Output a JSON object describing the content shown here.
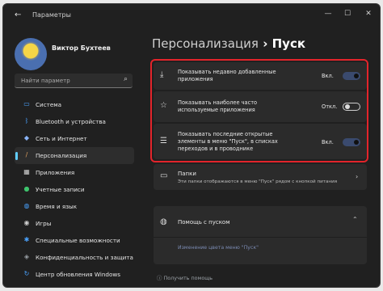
{
  "window": {
    "title": "Параметры",
    "back_icon": "arrow-left-icon",
    "controls": [
      "—",
      "☐",
      "✕"
    ]
  },
  "user": {
    "name": "Виктор Бухтеев"
  },
  "search": {
    "placeholder": "Найти параметр"
  },
  "sidebar": {
    "items": [
      {
        "label": "Система",
        "icon": "monitor-icon",
        "color": "#4aa3ff"
      },
      {
        "label": "Bluetooth и устройства",
        "icon": "bluetooth-icon",
        "color": "#4aa3ff"
      },
      {
        "label": "Сеть и Интернет",
        "icon": "wifi-icon",
        "color": "#8ab4f8"
      },
      {
        "label": "Персонализация",
        "icon": "brush-icon",
        "color": "#e0a060"
      },
      {
        "label": "Приложения",
        "icon": "apps-icon",
        "color": "#cfcfcf"
      },
      {
        "label": "Учетные записи",
        "icon": "person-icon",
        "color": "#3ec46d"
      },
      {
        "label": "Время и язык",
        "icon": "globe-icon",
        "color": "#4aa3ff"
      },
      {
        "label": "Игры",
        "icon": "gamepad-icon",
        "color": "#cfcfcf"
      },
      {
        "label": "Специальные возможности",
        "icon": "accessibility-icon",
        "color": "#4aa3ff"
      },
      {
        "label": "Конфиденциальность и защита",
        "icon": "shield-icon",
        "color": "#9aa0a6"
      },
      {
        "label": "Центр обновления Windows",
        "icon": "update-icon",
        "color": "#4aa3ff"
      }
    ],
    "active_index": 3
  },
  "header": {
    "crumb1": "Персонализация",
    "separator": "›",
    "crumb2": "Пуск"
  },
  "settings": {
    "recent_apps": {
      "label": "Показывать недавно добавленные приложения",
      "state": "Вкл.",
      "on": true
    },
    "most_used": {
      "label": "Показывать наиболее часто используемые приложения",
      "state": "Откл.",
      "on": false
    },
    "recent_items": {
      "label": "Показывать последние открытые элементы в меню \"Пуск\", в списках переходов и в проводнике",
      "state": "Вкл.",
      "on": true
    }
  },
  "folders": {
    "title": "Папки",
    "description": "Эти папки отображаются в меню \"Пуск\" рядом с кнопкой питания"
  },
  "help": {
    "title": "Помощь с пуском",
    "link": "Изменение цвета меню \"Пуск\""
  },
  "footer": {
    "get_help": "Получить помощь"
  }
}
